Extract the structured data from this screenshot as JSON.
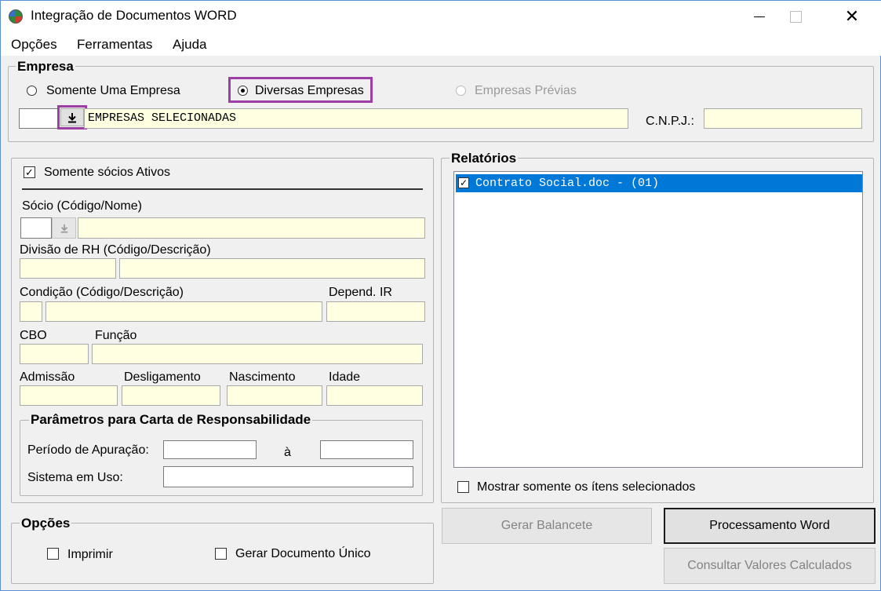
{
  "window": {
    "title": "Integração de Documentos WORD",
    "minimize": "—",
    "maximize": "☐",
    "close": "✕"
  },
  "menu": [
    {
      "label": "Opções"
    },
    {
      "label": "Ferramentas"
    },
    {
      "label": "Ajuda"
    }
  ],
  "empresa": {
    "legend": "Empresa",
    "radio_one": "Somente Uma Empresa",
    "radio_many": "Diversas Empresas",
    "radio_prev": "Empresas Prévias",
    "selected": "Diversas Empresas",
    "code_value": "",
    "name_value": "EMPRESAS SELECIONADAS",
    "cnpj_label": "C.N.P.J.:",
    "cnpj_value": ""
  },
  "socio": {
    "only_active_label": "Somente sócios Ativos",
    "only_active_checked": true,
    "socio_label": "Sócio (Código/Nome)",
    "divisao_label": "Divisão de RH (Código/Descrição)",
    "condicao_label": "Condição (Código/Descrição)",
    "depend_label": "Depend. IR",
    "cbo_label": "CBO",
    "funcao_label": "Função",
    "admissao_label": "Admissão",
    "desligamento_label": "Desligamento",
    "nascimento_label": "Nascimento",
    "idade_label": "Idade"
  },
  "carta": {
    "legend": "Parâmetros para Carta de Responsabilidade",
    "periodo_label": "Período de Apuração:",
    "ate_label": "à",
    "sistema_label": "Sistema em Uso:"
  },
  "opcoes": {
    "legend": "Opções",
    "imprimir_label": "Imprimir",
    "gerar_unico_label": "Gerar Documento Único"
  },
  "relatorios": {
    "legend": "Relatórios",
    "items": [
      {
        "label": "Contrato Social.doc - (01)",
        "checked": true,
        "selected": true
      }
    ],
    "show_selected_label": "Mostrar somente os ítens selecionados"
  },
  "buttons": {
    "gerar_balancete": "Gerar Balancete",
    "processamento_word": "Processamento Word",
    "consultar_valores": "Consultar Valores Calculados"
  },
  "icons": {
    "lookup": "download-arrow-icon",
    "check": "✓"
  },
  "colors": {
    "field_bg": "#ffffe1",
    "highlight": "#9b3fa5",
    "selection": "#0078d7"
  }
}
